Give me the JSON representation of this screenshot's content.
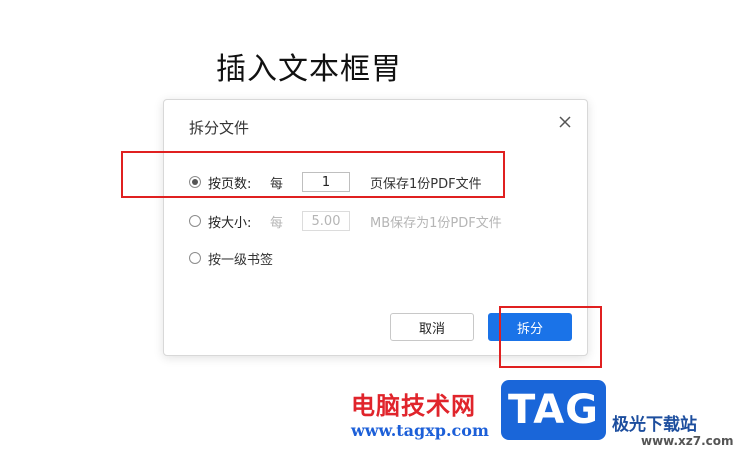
{
  "document": {
    "heading": "插入文本框胃"
  },
  "dialog": {
    "title": "拆分文件",
    "options": [
      {
        "label": "按页数:",
        "per": "每",
        "value": "1",
        "suffix": "页保存1份PDF文件",
        "checked": true,
        "enabled": true
      },
      {
        "label": "按大小:",
        "per": "每",
        "value": "5.00",
        "suffix": "MB保存为1份PDF文件",
        "checked": false,
        "enabled": false
      },
      {
        "label": "按一级书签",
        "checked": false,
        "enabled": true
      }
    ],
    "cancel_label": "取消",
    "split_label": "拆分",
    "accent_color": "#1a73e8"
  },
  "annotations": {
    "highlight_color": "#e02020"
  },
  "watermark": {
    "site_cn": "电脑技术网",
    "site_url": "www.tagxp.com",
    "logo_text": "TAG",
    "partner_cn": "极光下载站",
    "partner_url": "www.xz7.com"
  }
}
